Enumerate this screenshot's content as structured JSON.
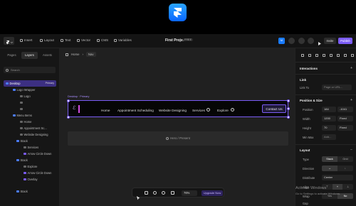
{
  "toolbar": {
    "items": [
      "Insert",
      "Layout",
      "Text",
      "Vector",
      "CMS",
      "Variables"
    ],
    "project_title": "First Project",
    "project_tag": "FREE",
    "invite_label": "Invite",
    "publish_label": "Publish"
  },
  "left_panel": {
    "tabs": [
      "Pages",
      "Layers",
      "Assets"
    ],
    "search_placeholder": "Search",
    "layers": [
      {
        "label": "Desktop",
        "badge": "Primary",
        "selected": true
      },
      {
        "label": "Logo Wrapper"
      },
      {
        "label": "Logo"
      },
      {
        "label": "Menu Items"
      },
      {
        "label": "Home"
      },
      {
        "label": "Appointment Sc..."
      },
      {
        "label": "Website Designing"
      },
      {
        "label": "Stack"
      },
      {
        "label": "Services"
      },
      {
        "label": "Arrow Circle Down"
      },
      {
        "label": "Stack"
      },
      {
        "label": "Explore"
      },
      {
        "label": "Arrow Circle Down"
      },
      {
        "label": "Overlay"
      },
      {
        "label": "Stack"
      }
    ]
  },
  "canvas": {
    "breadcrumb": [
      "Home",
      "Nav"
    ],
    "frame_label": "Desktop · Primary",
    "nav_items": [
      "Home",
      "Appointment Scheduling",
      "Website Designing",
      "Services",
      "Explore"
    ],
    "contact_label": "Contact Us",
    "hero_label": "Hero / Present",
    "zoom": "76%",
    "upgrade_label": "Upgrade Now"
  },
  "right_panel": {
    "interactions": "Interactions",
    "link_heading": "Link",
    "link_label": "Link To",
    "link_placeholder": "Page or URL...",
    "position_heading": "Position & Size",
    "position_label": "Position",
    "position_x": "184",
    "position_y": "-1041",
    "width_label": "Width",
    "width_value": "1200",
    "width_mode": "Fixed",
    "height_label": "Height",
    "height_value": "70",
    "height_mode": "Fixed",
    "minmax_label": "Min Max",
    "minmax_value": "Add...",
    "layout_heading": "Layout",
    "type_label": "Type",
    "type_options": [
      "Stack",
      "Grid"
    ],
    "direction_label": "Direction",
    "distribute_label": "Distribute",
    "distribute_value": "Center",
    "align_label": "Align",
    "wrap_label": "Wrap",
    "wrap_options": [
      "Yes",
      "No"
    ],
    "gap_label": "Gap"
  },
  "watermark": {
    "line1": "Activate Windows",
    "line2": "Go to Settings to activate Windows."
  },
  "colors": {
    "accent": "#7b5cf5",
    "selection": "#3c2f82",
    "logo": "#1a7cff"
  }
}
